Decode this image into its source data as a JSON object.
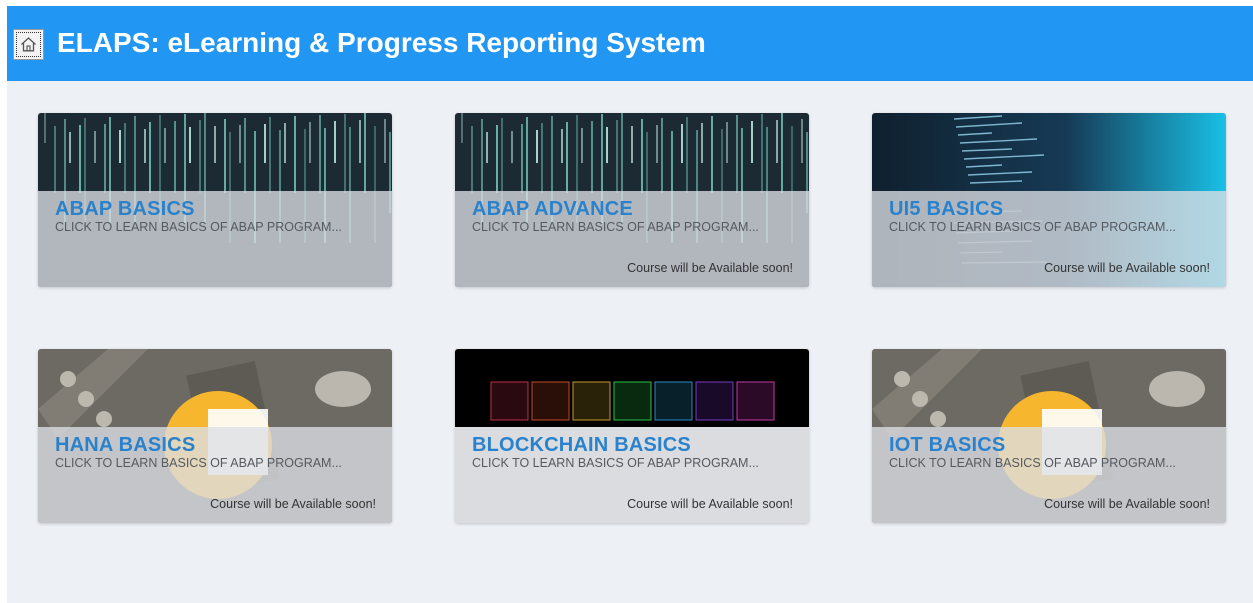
{
  "header": {
    "title": "ELAPS: eLearning & Progress Reporting System",
    "home_icon": "home-icon"
  },
  "colors": {
    "header_bg": "#2196f3",
    "page_bg": "#edf0f5",
    "tile_title": "#2b82cc"
  },
  "tiles": [
    {
      "title": "ABAP BASICS",
      "subtitle": "CLICK TO LEARN BASICS OF ABAP PROGRAM...",
      "footer": "",
      "image": "matrix-code"
    },
    {
      "title": "ABAP ADVANCE",
      "subtitle": "CLICK TO LEARN BASICS OF ABAP PROGRAM...",
      "footer": "Course will be Available soon!",
      "image": "matrix-code"
    },
    {
      "title": "UI5 BASICS",
      "subtitle": "CLICK TO LEARN BASICS OF ABAP PROGRAM...",
      "footer": "Course will be Available soon!",
      "image": "code-screen"
    },
    {
      "title": "HANA BASICS",
      "subtitle": "CLICK TO LEARN BASICS OF ABAP PROGRAM...",
      "footer": "Course will be Available soon!",
      "image": "hardware-circle"
    },
    {
      "title": "BLOCKCHAIN BASICS",
      "subtitle": "CLICK TO LEARN BASICS OF ABAP PROGRAM...",
      "footer": "Course will be Available soon!",
      "image": "blockchain-blocks"
    },
    {
      "title": "IOT BASICS",
      "subtitle": "CLICK TO LEARN BASICS OF ABAP PROGRAM...",
      "footer": "Course will be Available soon!",
      "image": "hardware-circle"
    }
  ]
}
